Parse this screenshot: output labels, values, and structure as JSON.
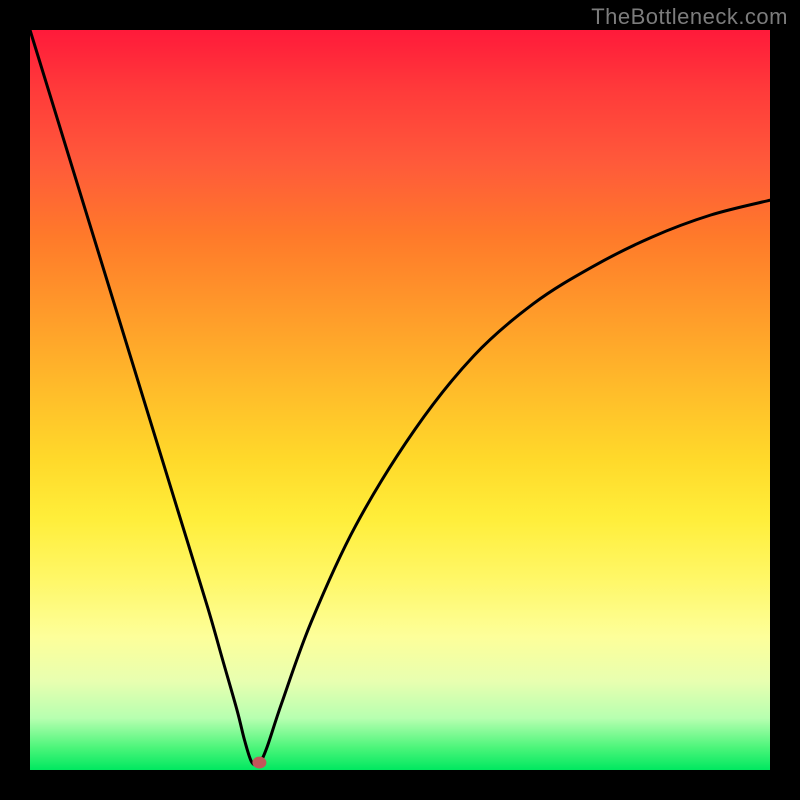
{
  "watermark": "TheBottleneck.com",
  "chart_data": {
    "type": "line",
    "title": "",
    "xlabel": "",
    "ylabel": "",
    "xlim": [
      0,
      100
    ],
    "ylim": [
      0,
      100
    ],
    "grid": false,
    "legend": false,
    "series": [
      {
        "name": "curve",
        "x": [
          0,
          4,
          8,
          12,
          16,
          20,
          24,
          26,
          28,
          29,
          30,
          31,
          32,
          34,
          38,
          44,
          52,
          60,
          68,
          76,
          84,
          92,
          100
        ],
        "y": [
          100,
          87,
          74,
          61,
          48,
          35,
          22,
          15,
          8,
          4,
          1,
          1,
          3,
          9,
          20,
          33,
          46,
          56,
          63,
          68,
          72,
          75,
          77
        ]
      }
    ],
    "marker": {
      "x": 31,
      "y": 1,
      "color": "#c2565a",
      "r": 7
    }
  }
}
